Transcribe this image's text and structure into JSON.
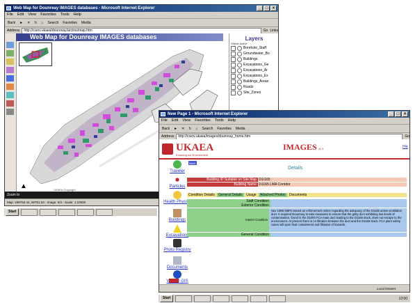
{
  "map_window": {
    "title": "Web Map for Dounreay IMAGES databases - Microsoft Internet Explorer",
    "menu": [
      "File",
      "Edit",
      "View",
      "Favorites",
      "Tools",
      "Help"
    ],
    "toolbar": [
      "Back",
      "Search",
      "Favorites",
      "Media"
    ],
    "address_label": "Address",
    "address_value": "http://cserv.ukaea/dounreay/arcims/map.htm",
    "links_label": "Links",
    "map_title": "Web Map for Dounreay IMAGES databases",
    "layers_title": "Layers",
    "layers_header": "Visible Active",
    "layers": [
      "Borehole_Staff",
      "Groundwater_Bo",
      "Buildings",
      "Excavations_Ge",
      "Excavations_Ar",
      "Excavations_Ex",
      "Buildings_Areas",
      "Roads",
      "Site_Zones"
    ],
    "zoom_status": "Zoom In",
    "copyright": "UKAEA Copyright",
    "status_bar": "Map: 299750.44, 96751.53 - Image: 6/3 - Scale: 1:10000"
  },
  "detail_window": {
    "title": "New Page 1 - Microsoft Internet Explorer",
    "menu": [
      "File",
      "Edit",
      "View",
      "Favorites",
      "Tools",
      "Help"
    ],
    "toolbar": [
      "Back",
      "Search",
      "Favorites",
      "Media"
    ],
    "address_label": "Address",
    "address_value": "http://cserv.ukaea/images/dounreay_home.htm",
    "logo_text": "UKAEA",
    "logo_tagline": "Ensuring our Environment",
    "images_title": "IMAGES",
    "images_suffix": "v1.0",
    "help_link": "He",
    "back_button": "Back",
    "section_title": "Details",
    "nav_items": [
      "Traveler",
      "Particles",
      "Health Physics",
      "Buildings",
      "Excavations",
      "Photo Registry",
      "Documents",
      "View in GIS"
    ],
    "building_rows": [
      {
        "label": "Building ID Suitable on Site Map",
        "value": "D1/165"
      },
      {
        "label": "Building Name",
        "value": "D1165 LMA Corridor"
      }
    ],
    "tabs": [
      "Condition Details",
      "General Details",
      "Usage",
      "Attached Photos",
      "Documents"
    ],
    "condition_rows": [
      {
        "label": "Staff Condition",
        "value": ""
      },
      {
        "label": "Exterior Condition",
        "value": ""
      },
      {
        "label": "Interior Condition",
        "value": "Nov 1996 OBPs issued an enforcement notice regarding the adequacy of the D1165 active ventilation duct. It required Dounreay to take measures to ensure that the gritty duct exhibiting low levels of contamination, found in the D1000 FCA main duct leading to the D1165 stack, does not escape to the environment. At present there is no filtration between the duct and the D1165 stack. FCA plant safety cases will upon final containment and filtration of hazards."
      },
      {
        "label": "General Condition",
        "value": ""
      }
    ],
    "status_done": "Local intranet"
  },
  "colors": {
    "titlebar": "#0a246a",
    "header_bar": "#4a5bd6",
    "building_label_bg": "#c23b3b",
    "building_value_bg": "#f5c9b3",
    "tab_bg": "#f2e28a",
    "label_bg": "#8fd18a",
    "value_bg": "#a9c8ee",
    "map_accent": "#d43adf"
  }
}
